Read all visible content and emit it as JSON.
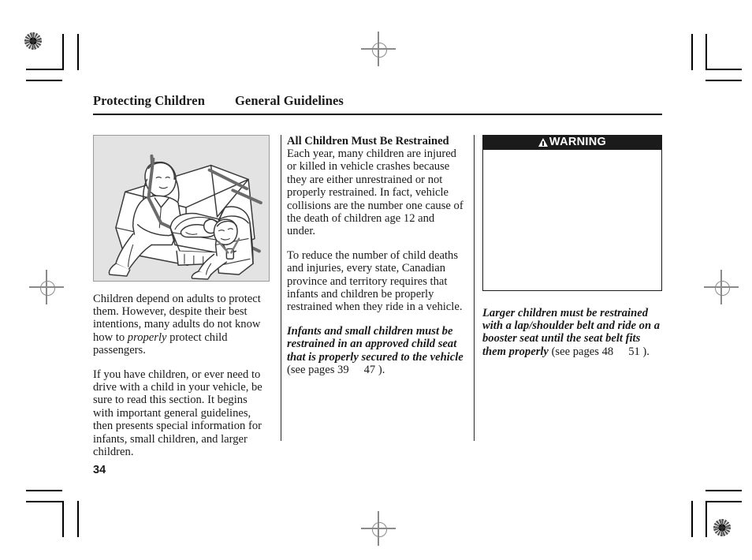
{
  "header": {
    "chapter": "Protecting Children",
    "section": "General Guidelines"
  },
  "left_column": {
    "illustration_name": "rear-seat-child-restraint-illustration",
    "paragraphs": {
      "p1_a": "Children depend on adults to protect them. However, despite their best intentions, many adults do not know how to ",
      "p1_italic": "properly",
      "p1_b": " protect child passengers.",
      "p2": "If you have children, or ever need to drive with a child in your vehicle, be sure to read this section. It begins with important general guidelines, then presents special information for infants, small children, and larger children."
    }
  },
  "middle_column": {
    "subhead": "All Children Must Be Restrained",
    "p1": "Each year, many children are injured or killed in vehicle crashes because they are either unrestrained or not properly restrained. In fact, vehicle collisions are the number one cause of the death of children age 12 and under.",
    "p2": "To reduce the number of child deaths and injuries, every state, Canadian province and territory requires that infants and children be properly restrained when they ride in a vehicle.",
    "p3_bold_italic": "Infants and small children must be restrained in an approved child seat that is properly secured to the vehicle",
    "p3_ref_prefix": " (see pages ",
    "p3_page_from": "39",
    "p3_page_to": "47",
    "p3_ref_suffix": " ).",
    "divider_name": "column-divider"
  },
  "right_column": {
    "warning": {
      "icon": "warning-triangle-icon",
      "label": "WARNING",
      "body_text": ""
    },
    "p1_bold_italic": "Larger children must be restrained with a lap/shoulder belt and ride on a booster seat until the seat belt fits them properly",
    "p1_ref_prefix": " (see pages ",
    "p1_page_from": "48",
    "p1_page_to": "51",
    "p1_ref_suffix": " )."
  },
  "footer": {
    "page_number": "34"
  },
  "print_marks": {
    "registration_target_top_left": "registration-target-icon",
    "registration_target_bottom_right": "registration-target-icon",
    "crosshair_top_center": "crosshair-registration-icon",
    "crosshair_bottom_center": "crosshair-registration-icon",
    "crosshair_left_middle": "crosshair-registration-icon",
    "crosshair_right_middle": "crosshair-registration-icon"
  },
  "colors": {
    "text": "#1a1a1a",
    "warning_bar": "#1b1b1b",
    "illustration_bg": "#e3e3e3",
    "rule": "#000000"
  }
}
